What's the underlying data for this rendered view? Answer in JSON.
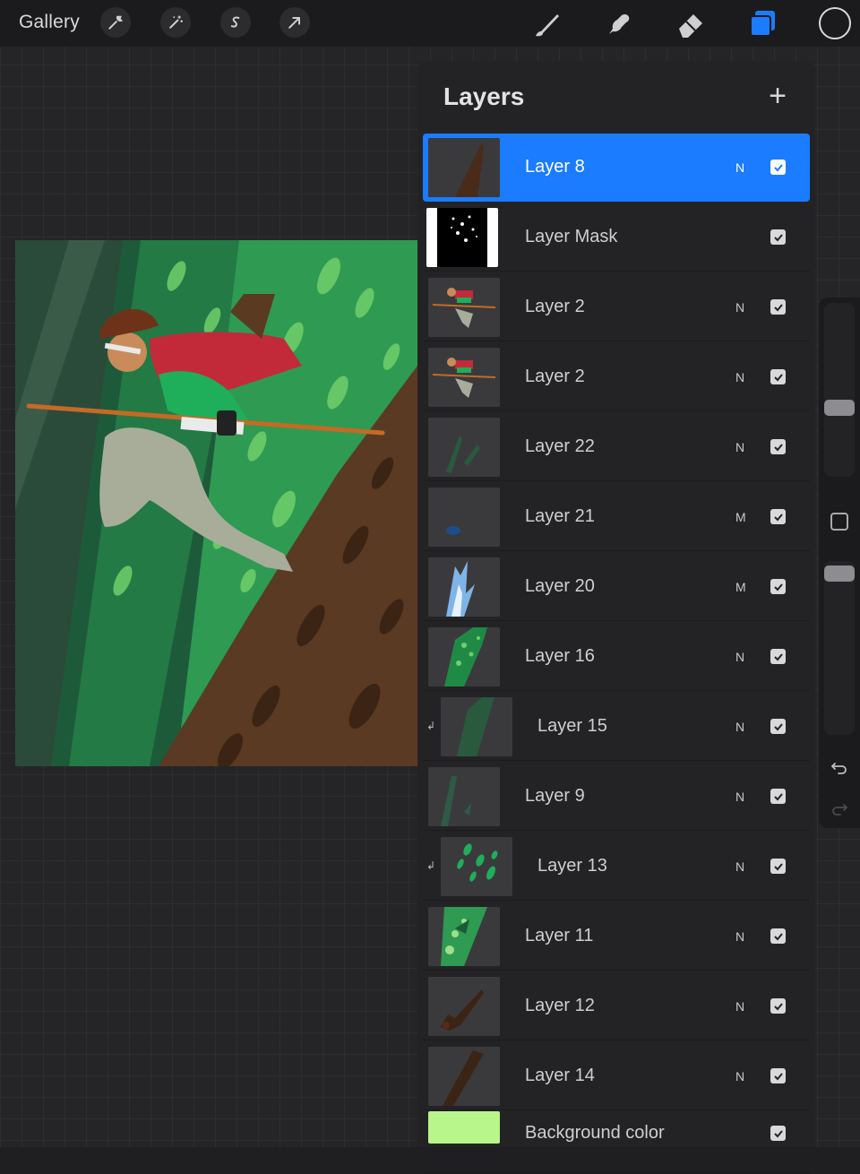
{
  "topbar": {
    "gallery_label": "Gallery",
    "left_tools": [
      "wrench-icon",
      "magic-wand-icon",
      "selection-icon",
      "transform-arrow-icon"
    ],
    "right_tools": [
      "brush-icon",
      "smudge-icon",
      "eraser-icon",
      "layers-icon"
    ],
    "active_tool": "layers-icon",
    "current_color": "#1b1b1d"
  },
  "layers_panel": {
    "title": "Layers",
    "add_label": "+",
    "layers": [
      {
        "name": "Layer 8",
        "blend": "N",
        "visible": true,
        "selected": true,
        "clipped": false
      },
      {
        "name": "Layer Mask",
        "blend": "",
        "visible": true,
        "selected": false,
        "clipped": false
      },
      {
        "name": "Layer 2",
        "blend": "N",
        "visible": true,
        "selected": false,
        "clipped": false
      },
      {
        "name": "Layer 2",
        "blend": "N",
        "visible": true,
        "selected": false,
        "clipped": false
      },
      {
        "name": "Layer 22",
        "blend": "N",
        "visible": true,
        "selected": false,
        "clipped": false
      },
      {
        "name": "Layer 21",
        "blend": "M",
        "visible": true,
        "selected": false,
        "clipped": false
      },
      {
        "name": "Layer 20",
        "blend": "M",
        "visible": true,
        "selected": false,
        "clipped": false
      },
      {
        "name": "Layer 16",
        "blend": "N",
        "visible": true,
        "selected": false,
        "clipped": false
      },
      {
        "name": "Layer 15",
        "blend": "N",
        "visible": true,
        "selected": false,
        "clipped": true
      },
      {
        "name": "Layer 9",
        "blend": "N",
        "visible": true,
        "selected": false,
        "clipped": false
      },
      {
        "name": "Layer 13",
        "blend": "N",
        "visible": true,
        "selected": false,
        "clipped": true
      },
      {
        "name": "Layer 11",
        "blend": "N",
        "visible": true,
        "selected": false,
        "clipped": false
      },
      {
        "name": "Layer 12",
        "blend": "N",
        "visible": true,
        "selected": false,
        "clipped": false
      },
      {
        "name": "Layer 14",
        "blend": "N",
        "visible": true,
        "selected": false,
        "clipped": false
      },
      {
        "name": "Background color",
        "blend": "",
        "visible": true,
        "selected": false,
        "clipped": false
      }
    ]
  },
  "colors": {
    "accent": "#1b7cff",
    "background_color_swatch": "#b8f58a"
  },
  "sidebar": {
    "brush_size_level": 0.66,
    "opacity_level": 0.97
  }
}
